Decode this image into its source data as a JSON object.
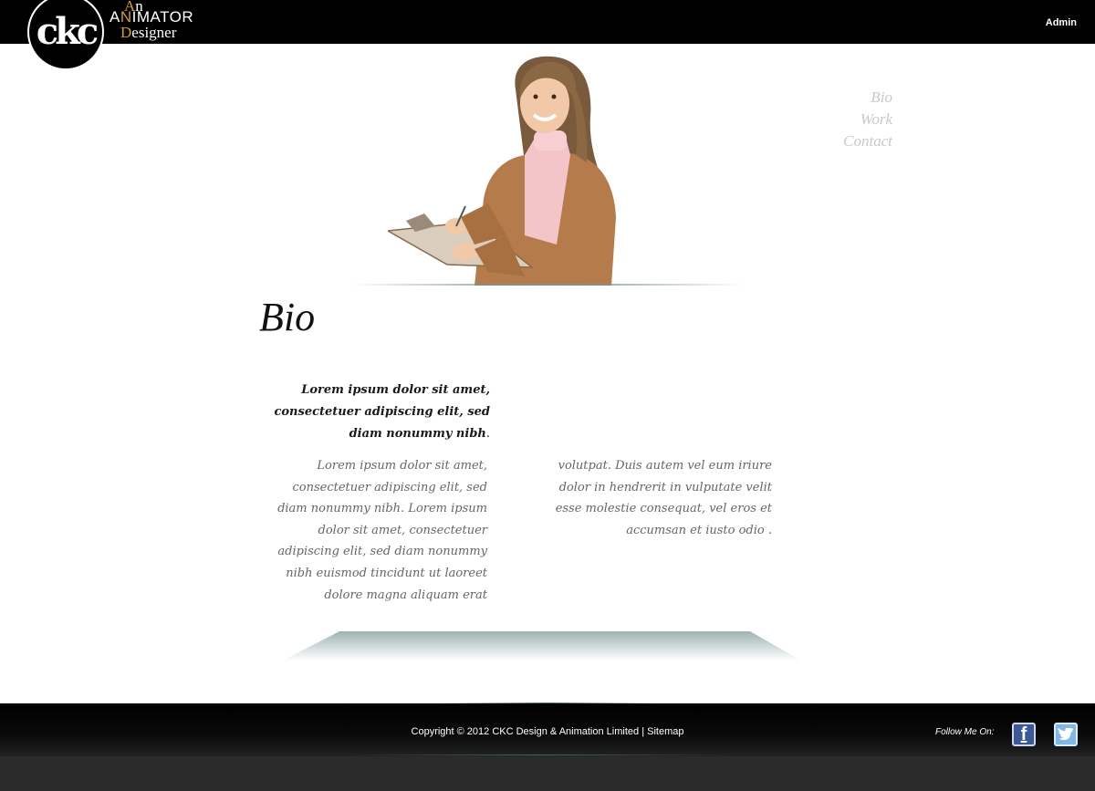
{
  "header": {
    "logo_text": "ckc",
    "tagline_1a": "A",
    "tagline_1b": "n",
    "tagline_2a": "A",
    "tagline_2b": "N",
    "tagline_2c": "IMATOR",
    "tagline_3a": "D",
    "tagline_3b": "esigner",
    "admin_label": "Admin"
  },
  "nav": {
    "items": [
      {
        "label": "Bio"
      },
      {
        "label": "Work"
      },
      {
        "label": "Contact"
      }
    ]
  },
  "content": {
    "heading": "Bio",
    "intro": "Lorem ipsum dolor sit amet, consectetuer adipiscing elit, sed diam nonummy nibh",
    "intro_end": ".",
    "col_left": "Lorem ipsum dolor sit amet, consectetuer adipiscing elit, sed diam nonummy nibh. Lorem ipsum dolor sit amet, consectetuer adipiscing elit, sed diam nonummy nibh euismod tincidunt ut laoreet dolore magna aliquam erat",
    "col_right": "volutpat. Duis autem vel eum iriure dolor in hendrerit in vulputate velit esse molestie consequat, vel eros et accumsan et iusto odio ."
  },
  "footer": {
    "copyright": "Copyright © 2012 CKC Design & Animation Limited",
    "separator": "|",
    "sitemap": "Sitemap",
    "follow": "Follow Me On:",
    "facebook_glyph": "f"
  },
  "colors": {
    "accent_gold": "#d4a017",
    "nav_grey": "#c9c9c9",
    "teal_line": "#7a9494"
  },
  "icons": [
    "facebook-icon",
    "twitter-icon"
  ]
}
